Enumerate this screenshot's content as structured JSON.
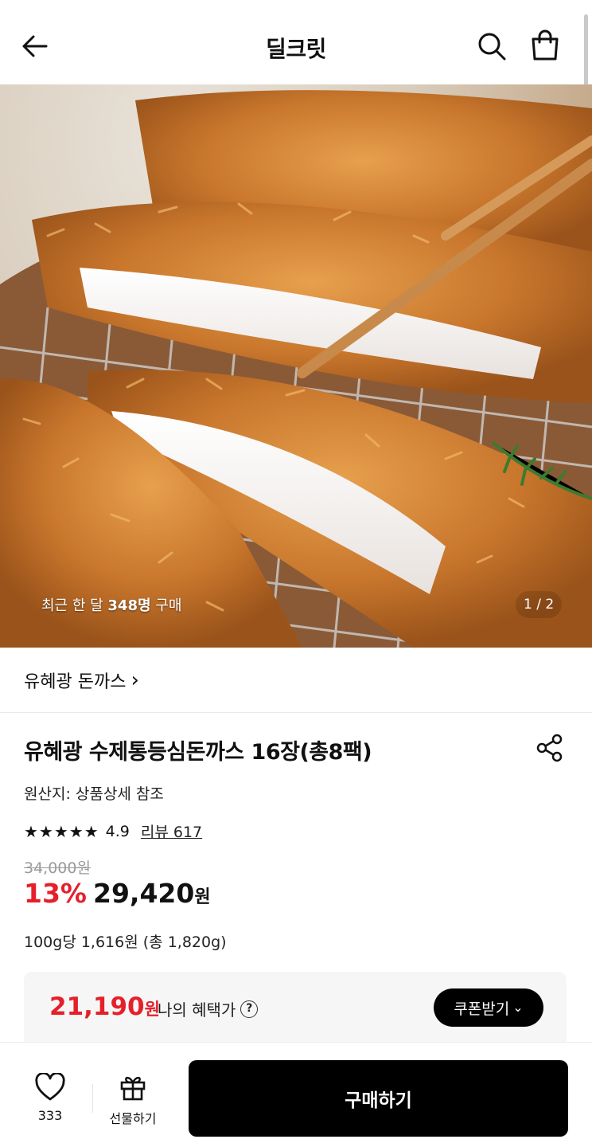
{
  "header": {
    "title": "딜크릿",
    "back_icon": "arrow-left-icon",
    "search_icon": "search-icon",
    "cart_icon": "shopping-bag-icon"
  },
  "hero": {
    "stat_prefix": "최근 한 달 ",
    "stat_count": "348명",
    "stat_suffix": " 구매",
    "pager": "1 / 2"
  },
  "brand": {
    "name": "유혜광 돈까스",
    "chevron": "›"
  },
  "product": {
    "title": "유혜광 수제통등심돈까스 16장(총8팩)",
    "origin": "원산지: 상품상세 참조",
    "stars": "★★★★★",
    "rating": "4.9",
    "review_label": "리뷰 617",
    "original_price": "34,000원",
    "discount": "13%",
    "price": "29,420",
    "price_unit": "원",
    "unit_price": "100g당 1,616원 (총 1,820g)"
  },
  "benefit": {
    "amount": "21,190",
    "amount_unit": "원",
    "label": "나의 혜택가",
    "help": "?",
    "coupon_label": "쿠폰받기",
    "coupon_chevron": "⌄"
  },
  "bottom": {
    "like_count": "333",
    "gift_label": "선물하기",
    "buy_label": "구매하기"
  },
  "colors": {
    "accent": "#e5202b",
    "primary": "#000000"
  }
}
